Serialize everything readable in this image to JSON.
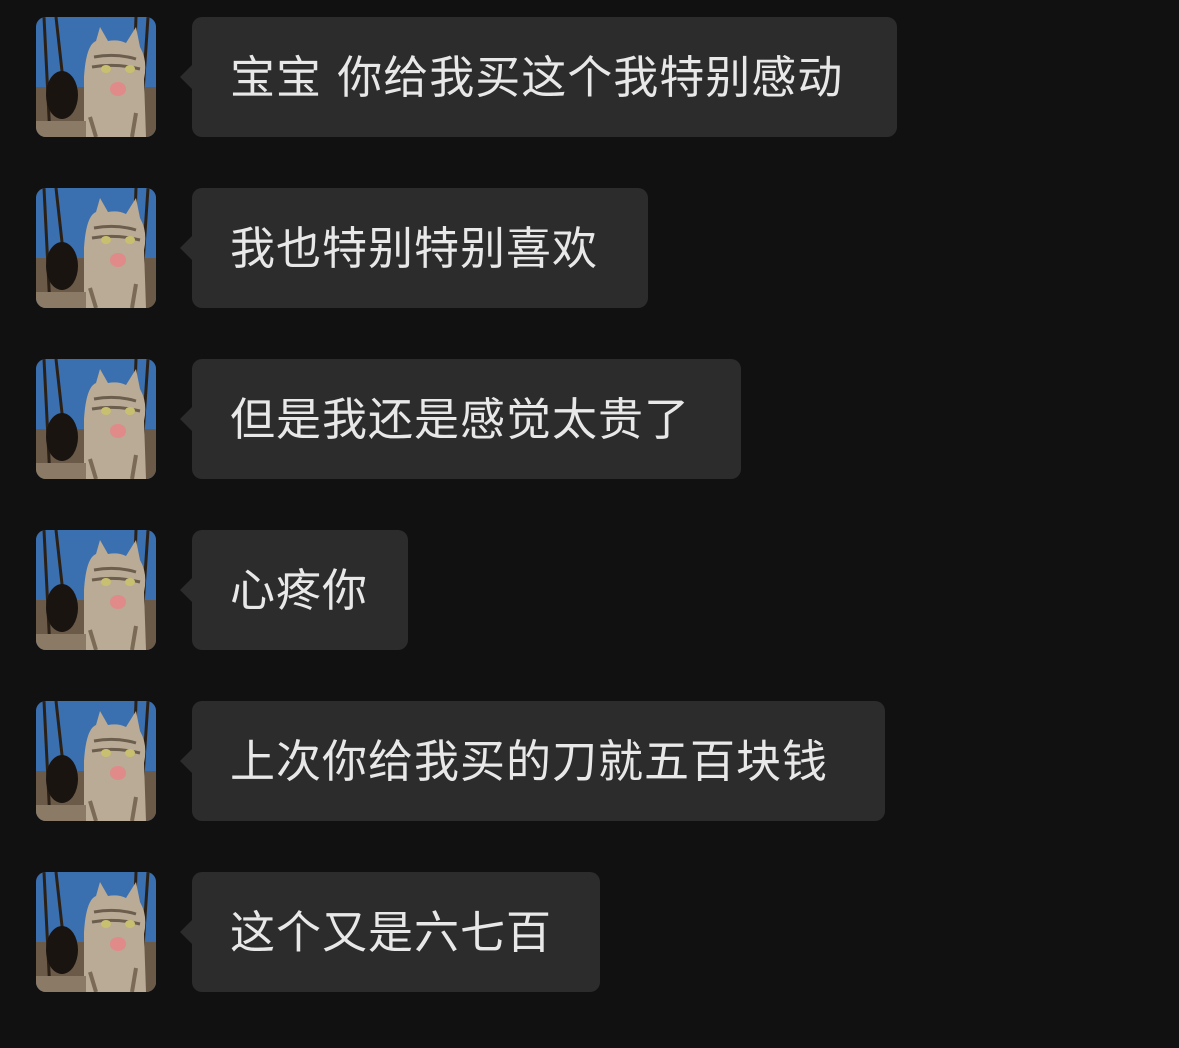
{
  "theme": {
    "background": "#111111",
    "bubble": "#2c2c2c",
    "text": "#e8e8e8"
  },
  "sender": {
    "avatar_icon": "tabby-cat-avatar-icon"
  },
  "messages": [
    {
      "text": "宝宝 你给我买这个我特别感动"
    },
    {
      "text": "我也特别特别喜欢"
    },
    {
      "text": "但是我还是感觉太贵了"
    },
    {
      "text": "心疼你"
    },
    {
      "text": "上次你给我买的刀就五百块钱"
    },
    {
      "text": "这个又是六七百"
    }
  ]
}
